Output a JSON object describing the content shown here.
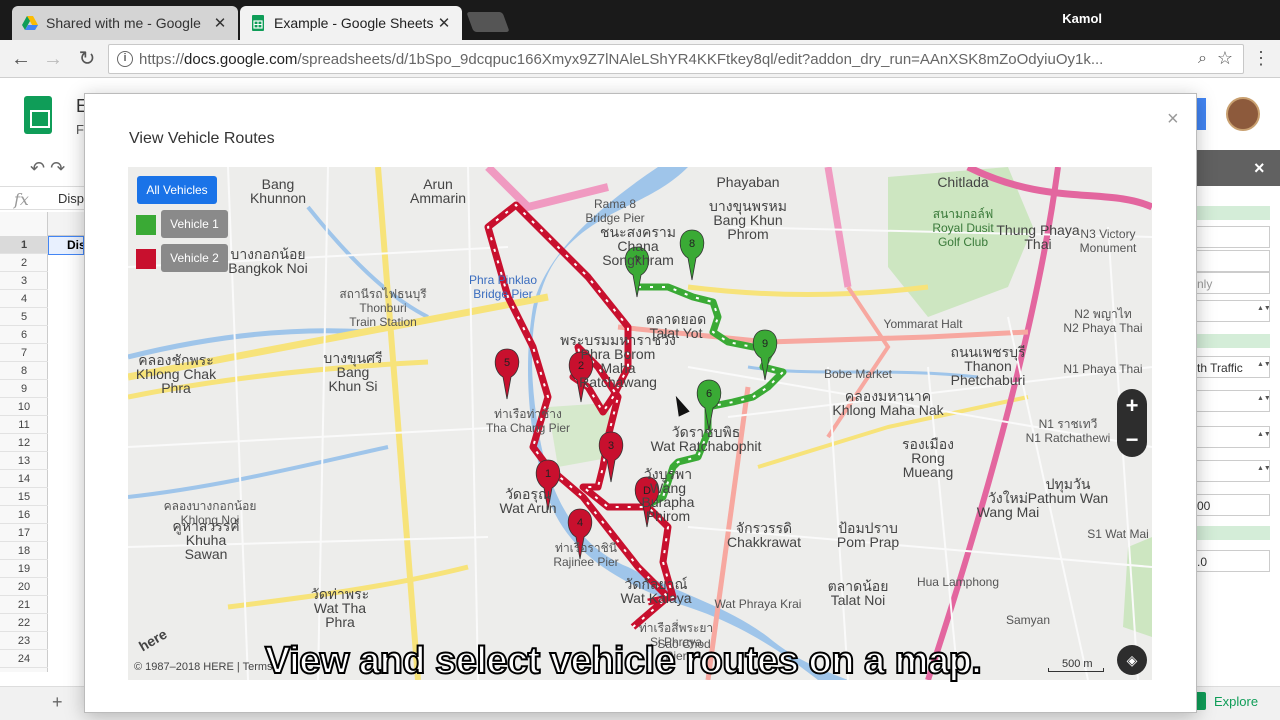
{
  "browser": {
    "tabs": [
      {
        "label": "Shared with me - Google",
        "active": false
      },
      {
        "label": "Example - Google Sheets",
        "active": true
      }
    ],
    "profile_name": "Kamol",
    "url": {
      "scheme": "https://",
      "host": "docs.google.com",
      "path": "/spreadsheets/d/1bSpo_9dcqpuc166Xmyx9Z7lNAleLShYR4KKFtkey8ql/edit?addon_dry_run=AAnXSK8mZoOdyiuOy1k..."
    }
  },
  "sheets": {
    "title_fragment": "E",
    "menu_fragment": "F",
    "formula_label": "fx",
    "formula_value": "Disp",
    "cell_a1": "Dis",
    "rows": [
      "1",
      "2",
      "3",
      "4",
      "5",
      "6",
      "7",
      "8",
      "9",
      "10",
      "11",
      "12",
      "13",
      "14",
      "15",
      "16",
      "17",
      "18",
      "19",
      "20",
      "21",
      "22",
      "23",
      "24"
    ],
    "add_sheet_label": "+",
    "explore_label": "Explore"
  },
  "sidebar": {
    "close": "×",
    "fields": [
      {
        "text": "",
        "muted": false,
        "select": false
      },
      {
        "text": "",
        "muted": false,
        "select": false
      },
      {
        "text": "nly",
        "muted": true,
        "select": false
      },
      {
        "text": "",
        "muted": false,
        "select": true
      },
      {
        "text": "th Traffic",
        "muted": false,
        "select": true
      },
      {
        "text": "",
        "muted": false,
        "select": true
      },
      {
        "text": "",
        "muted": false,
        "select": true
      },
      {
        "text": "",
        "muted": false,
        "select": true
      },
      {
        "text": "00",
        "muted": false,
        "select": false
      },
      {
        "text": ".0",
        "muted": false,
        "select": false
      }
    ]
  },
  "modal": {
    "title": "View Vehicle Routes",
    "close": "×"
  },
  "map": {
    "buttons": {
      "all": "All Vehicles",
      "vehicle1": "Vehicle 1",
      "vehicle2": "Vehicle 2"
    },
    "colors": {
      "vehicle1": "#3aaa35",
      "vehicle2": "#c8102e",
      "all": "#1a73e8"
    },
    "zoom_in": "+",
    "zoom_out": "−",
    "scale": "500 m",
    "copyright": "© 1987–2018 HERE | Terms",
    "here_logo": "here",
    "caption": "View and select vehicle routes on a map.",
    "labels": [
      {
        "text": "Bang\nKhunnon",
        "cls": "big"
      },
      {
        "text": "Arun\nAmmarin",
        "cls": "big"
      },
      {
        "text": "Phayaban",
        "cls": "big"
      },
      {
        "text": "Chitlada",
        "cls": "big"
      },
      {
        "text": "บางกอกน้อย\nBangkok Noi",
        "cls": "big"
      },
      {
        "text": "บางขุนพรหม\nBang Khun\nPhrom",
        "cls": "big"
      },
      {
        "text": "สนามกอล์ฟ\nRoyal Dusit\nGolf Club",
        "cls": "park"
      },
      {
        "text": "Thung Phaya\nThai",
        "cls": "big"
      },
      {
        "text": "สถานีรถไฟธนบุรี\nThonburi\nTrain Station",
        "cls": ""
      },
      {
        "text": "Phra Pinklao\nBridge Pier",
        "cls": "water"
      },
      {
        "text": "Rama 8\nBridge Pier",
        "cls": ""
      },
      {
        "text": "ชนะสงคราม\nChana\nSongkhram",
        "cls": "big"
      },
      {
        "text": "ตลาดยอด\nTalat Yot",
        "cls": "big"
      },
      {
        "text": "Yommarat Halt",
        "cls": ""
      },
      {
        "text": "คลองชักพระ\nKhlong Chak\nPhra",
        "cls": "big"
      },
      {
        "text": "บางขุนศรี\nBang\nKhun Si",
        "cls": "big"
      },
      {
        "text": "พระบรมมหาราชวัง\nPhra Borom\nMaha\nRatchawang",
        "cls": "big"
      },
      {
        "text": "Bobe Market",
        "cls": ""
      },
      {
        "text": "ถนนเพชรบุรี\nThanon\nPhetchaburi",
        "cls": "big"
      },
      {
        "text": "ท่าเรือท่าช้าง\nTha Chang Pier",
        "cls": ""
      },
      {
        "text": "วัดราชบพิธ\nWat Ratchabophit",
        "cls": "big"
      },
      {
        "text": "คลองมหานาค\nKhlong Maha Nak",
        "cls": "big"
      },
      {
        "text": "N1 ราชเทวี\nN1 Ratchathewi",
        "cls": ""
      },
      {
        "text": "รองเมือง\nRong\nMueang",
        "cls": "big"
      },
      {
        "text": "วัดอรุณ\nWat Arun",
        "cls": "big"
      },
      {
        "text": "วังบูรพา\nWang\nBurapha\nPhirom",
        "cls": "big"
      },
      {
        "text": "ปทุมวัน\nPathum Wan",
        "cls": "big"
      },
      {
        "text": "คลองบางกอกน้อย\nKhlong Noi",
        "cls": ""
      },
      {
        "text": "คูหาสวรรค์\nKhuha\nSawan",
        "cls": "big"
      },
      {
        "text": "ท่าเรือราชินี\nRajinee Pier",
        "cls": ""
      },
      {
        "text": "จักรวรรดิ\nChakkrawat",
        "cls": "big"
      },
      {
        "text": "ป้อมปราบ\nPom Prap",
        "cls": "big"
      },
      {
        "text": "วังใหม่\nWang Mai",
        "cls": "big"
      },
      {
        "text": "วัดท่าพระ\nWat Tha\nPhra",
        "cls": "big"
      },
      {
        "text": "วัดกัลยาณ์\nWat Kalaya",
        "cls": "big"
      },
      {
        "text": "Hua Lamphong",
        "cls": ""
      },
      {
        "text": "ตลาดน้อย\nTalat Noi",
        "cls": "big"
      },
      {
        "text": "Samyan",
        "cls": ""
      },
      {
        "text": "ท่าเรือสี่พระยา\nSi Phraya\nPier",
        "cls": ""
      },
      {
        "text": "Sao Chod",
        "cls": ""
      },
      {
        "text": "N2 พญาไท\nN2 Phaya Thai",
        "cls": ""
      },
      {
        "text": "N3 Victory\nMonument",
        "cls": ""
      },
      {
        "text": "N1 Phaya Thai",
        "cls": ""
      },
      {
        "text": "S1 Wat Mai",
        "cls": ""
      },
      {
        "text": "Wat Phraya Krai",
        "cls": ""
      }
    ],
    "markers": [
      {
        "label": "1",
        "vehicle": "vehicle2"
      },
      {
        "label": "2",
        "vehicle": "vehicle2"
      },
      {
        "label": "3",
        "vehicle": "vehicle2"
      },
      {
        "label": "4",
        "vehicle": "vehicle2"
      },
      {
        "label": "5",
        "vehicle": "vehicle2"
      },
      {
        "label": "D",
        "vehicle": "vehicle2"
      },
      {
        "label": "6",
        "vehicle": "vehicle1"
      },
      {
        "label": "7",
        "vehicle": "vehicle1"
      },
      {
        "label": "8",
        "vehicle": "vehicle1"
      },
      {
        "label": "9",
        "vehicle": "vehicle1"
      }
    ]
  }
}
